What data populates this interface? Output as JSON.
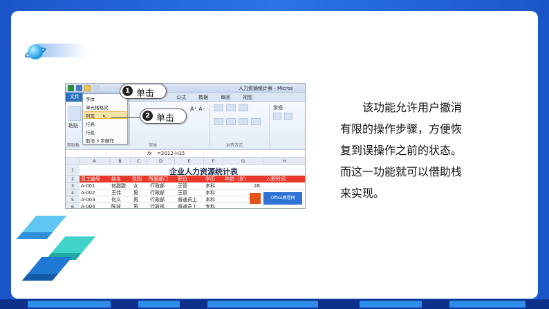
{
  "paragraph": {
    "lines": [
      "该功能允许用户撤消",
      "有限的操作步骤，方便恢",
      "复到误操作之前的状态。",
      "而这一功能就可以借助栈",
      "来实现。"
    ]
  },
  "callouts": [
    {
      "num": "1",
      "text": "单击"
    },
    {
      "num": "2",
      "text": "单击"
    }
  ],
  "excel": {
    "window_title": "人力资源统计表 - Micros",
    "file_tab": "文件",
    "tabs": [
      "公式",
      "数据",
      "审阅",
      "视图"
    ],
    "dropdown_items": [
      "字体",
      "单元格格式",
      "列宽",
      "行高",
      "行高",
      "取消 3 步操作"
    ],
    "ribbon": {
      "paste": "粘贴",
      "clipboard": "剪贴板",
      "font_group": "字体",
      "align_group": "对齐方式",
      "general": "常规"
    },
    "formula": {
      "fx": "fx",
      "content": "=2012-H15"
    },
    "columns": [
      "A",
      "B",
      "C",
      "D",
      "E",
      "F",
      "G",
      "H"
    ],
    "row_numbers": [
      "1",
      "2",
      "3",
      "4",
      "5",
      "6"
    ],
    "sheet_title": "企业人力资源统计表",
    "headers": [
      "员工编号",
      "姓名",
      "性别",
      "所属部门",
      "职位",
      "学历",
      "年龄（岁）",
      "入职时间"
    ],
    "rows": [
      [
        "A-001",
        "何甜甜",
        "女",
        "行政部",
        "王管",
        "本科",
        "28"
      ],
      [
        "A-002",
        "王伟",
        "男",
        "行政部",
        "王管",
        "本科",
        "26"
      ],
      [
        "A-003",
        "何义",
        "男",
        "行政部",
        "普通员工",
        "本科",
        ""
      ],
      [
        "A-004",
        "陈波",
        "男",
        "行政部",
        "普通员工",
        "专科",
        ""
      ]
    ],
    "logo_text": "Office教程网"
  },
  "colors": {
    "frame": "#1d5fd6",
    "header_row": "#e8392b",
    "cube_light": "#5fc7f2",
    "cube_teal": "#3fd3c9",
    "cube_dark": "#1f78d1"
  }
}
